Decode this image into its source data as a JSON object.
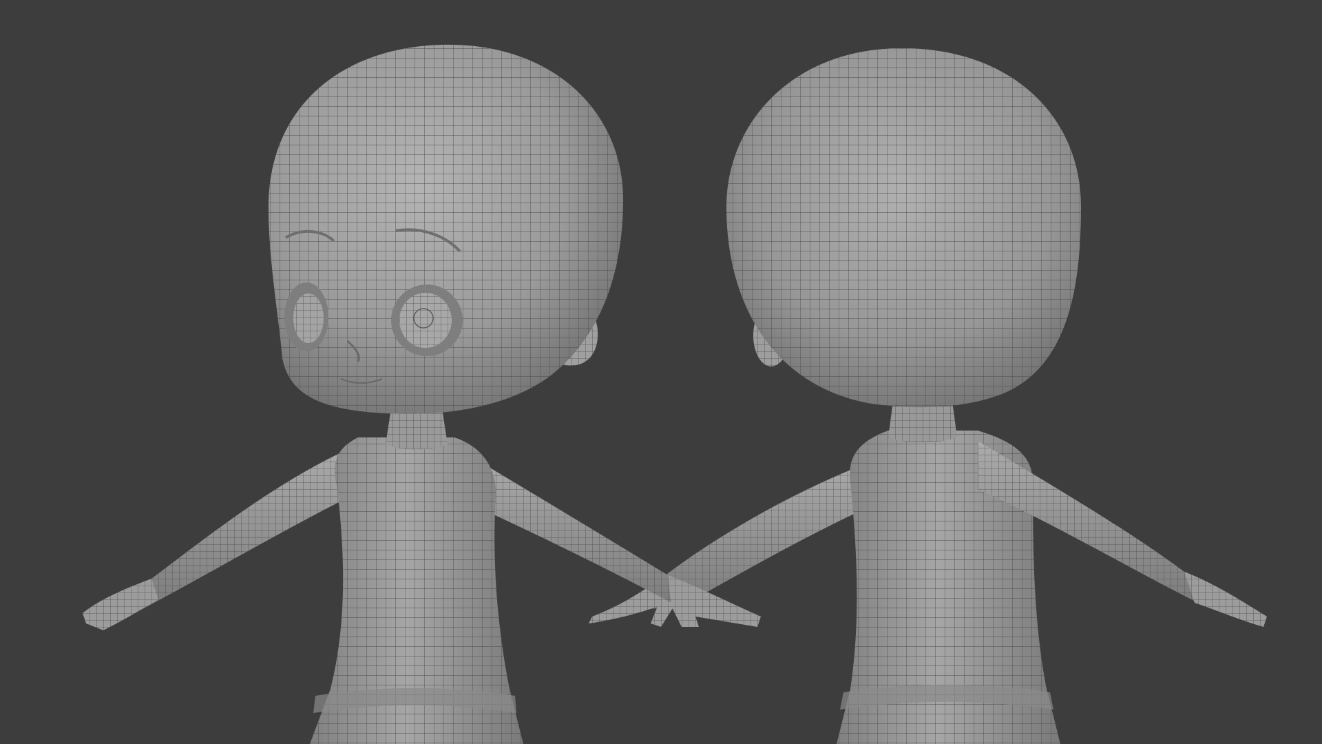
{
  "scene": {
    "background_color": "#3d3d3d",
    "mesh_color": "#9c9c9c",
    "wire_color": "#4a4a4a",
    "models": [
      {
        "view": "front-three-quarter"
      },
      {
        "view": "back-three-quarter"
      }
    ]
  }
}
